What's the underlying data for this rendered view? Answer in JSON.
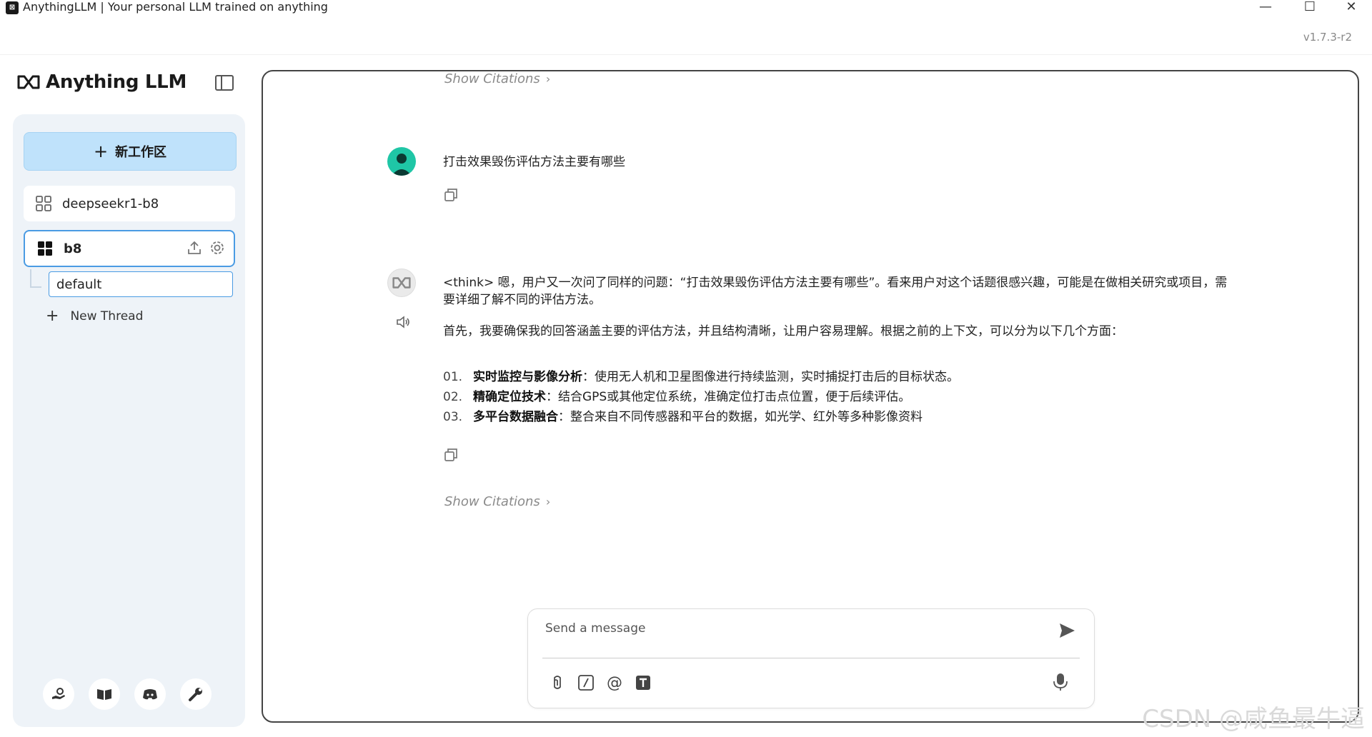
{
  "window": {
    "title": "AnythingLLM | Your personal LLM trained on anything",
    "version": "v1.7.3-r2",
    "controls": {
      "minimize": "—",
      "maximize": "☐",
      "close": "✕"
    }
  },
  "brand": {
    "name": "Anything LLM"
  },
  "sidebar": {
    "new_workspace_label": "新工作区",
    "workspaces": [
      {
        "name": "deepseekr1-b8",
        "active": false
      },
      {
        "name": "b8",
        "active": true
      }
    ],
    "threads": [
      {
        "name": "default",
        "active": true
      }
    ],
    "new_thread_label": "New Thread"
  },
  "chat": {
    "show_citations_label": "Show Citations",
    "messages": [
      {
        "role": "user",
        "text": "打击效果毁伤评估方法主要有哪些"
      },
      {
        "role": "assistant",
        "think_line": "<think> 嗯，用户又一次问了同样的问题：“打击效果毁伤评估方法主要有哪些”。看来用户对这个话题很感兴趣，可能是在做相关研究或项目，需要详细了解不同的评估方法。",
        "intro": "首先，我要确保我的回答涵盖主要的评估方法，并且结构清晰，让用户容易理解。根据之前的上下文，可以分为以下几个方面：",
        "items": [
          {
            "num": "01.",
            "title": "实时监控与影像分析",
            "desc": "：使用无人机和卫星图像进行持续监测，实时捕捉打击后的目标状态。"
          },
          {
            "num": "02.",
            "title": "精确定位技术",
            "desc": "：结合GPS或其他定位系统，准确定位打击点位置，便于后续评估。"
          },
          {
            "num": "03.",
            "title": "多平台数据融合",
            "desc": "：整合来自不同传感器和平台的数据，如光学、红外等多种影像资料"
          }
        ]
      }
    ]
  },
  "input": {
    "placeholder": "Send a message"
  },
  "watermark": "CSDN @咸鱼最牛逼"
}
